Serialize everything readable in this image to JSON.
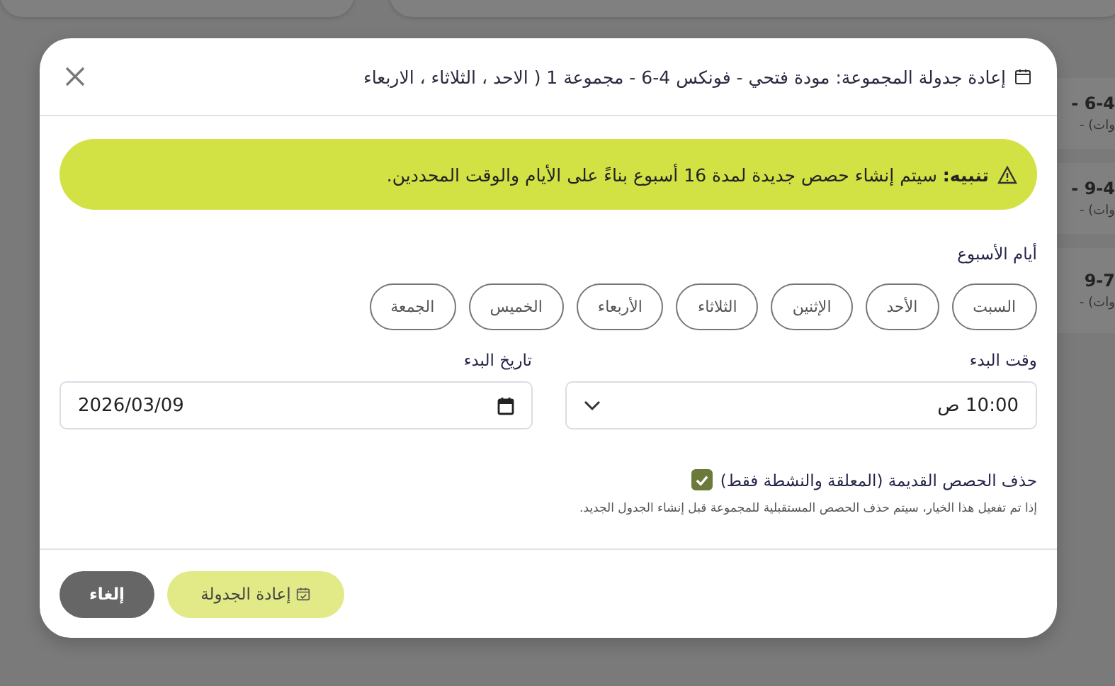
{
  "background_cards": [
    {
      "title": "6-4 -",
      "subtitle": "وات) -"
    },
    {
      "title": "9-4 -",
      "subtitle": "وات) -"
    },
    {
      "title": "9-7",
      "subtitle": "وات) -"
    }
  ],
  "dialog": {
    "title": "إعادة جدولة المجموعة: مودة فتحي - فونكس 4-6 - مجموعة 1 ( الاحد ، الثلاثاء ، الاربعاء",
    "alert": "**تنبيه:** سيتم إنشاء حصص جديدة لمدة 16 أسبوع بناءً على الأيام والوقت المحددين.",
    "days_label": "أيام الأسبوع",
    "days": [
      {
        "label": "السبت",
        "selected": false
      },
      {
        "label": "الأحد",
        "selected": false
      },
      {
        "label": "الإثنين",
        "selected": false
      },
      {
        "label": "الثلاثاء",
        "selected": false
      },
      {
        "label": "الأربعاء",
        "selected": false
      },
      {
        "label": "الخميس",
        "selected": false
      },
      {
        "label": "الجمعة",
        "selected": false
      }
    ],
    "start_time": {
      "label": "وقت البدء",
      "value": "10:00 ص"
    },
    "start_date": {
      "label": "تاريخ البدء",
      "value": "2026/03/09"
    },
    "delete_old": {
      "label": "حذف الحصص القديمة (المعلقة والنشطة فقط)",
      "checked": true,
      "hint": "إذا تم تفعيل هذا الخيار، سيتم حذف الحصص المستقبلية للمجموعة قبل إنشاء الجدول الجديد."
    },
    "buttons": {
      "cancel": "إلغاء",
      "reschedule": "إعادة الجدولة"
    }
  }
}
